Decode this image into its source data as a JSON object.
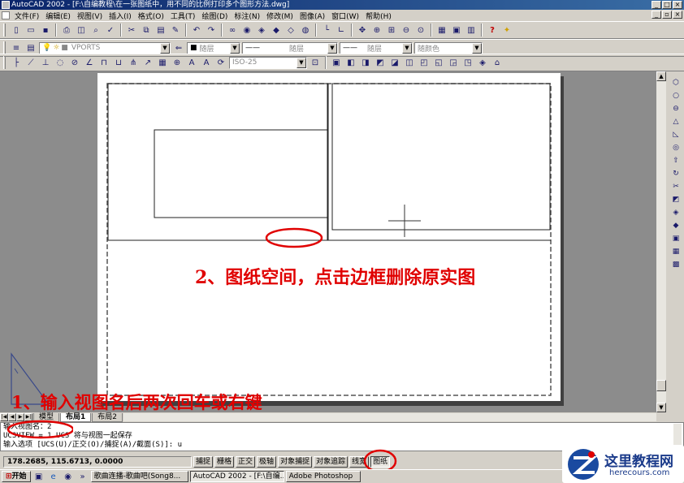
{
  "window": {
    "title": "AutoCAD 2002 - [F:\\自编教程\\在一张图纸中，用不同的比例打印多个图形方法.dwg]"
  },
  "menu": [
    "文件(F)",
    "编辑(E)",
    "视图(V)",
    "插入(I)",
    "格式(O)",
    "工具(T)",
    "绘图(D)",
    "标注(N)",
    "修改(M)",
    "图像(A)",
    "窗口(W)",
    "帮助(H)"
  ],
  "toolbar": {
    "layer_combo": "VPORTS",
    "color_combo": "随层",
    "linetype_combo": "随层",
    "lineweight_combo": "随层",
    "plotstyle_combo": "随颜色",
    "dimstyle_combo": "ISO-25"
  },
  "annotations": {
    "step2": "2、图纸空间，点击边框删除原实图",
    "step1": "1、输入视图名后两次回车或右键"
  },
  "tabs": [
    "模型",
    "布局1",
    "布局2"
  ],
  "active_tab": 1,
  "command_lines": [
    "输入视图名：2",
    "UCSVIEW = 1  UCS 将与视图一起保存",
    "输入选项 [UCS(U)/正交(O)/捕捉(A)/截面(S)]: u"
  ],
  "status": {
    "coords": "178.2685, 115.6713, 0.0000",
    "buttons": [
      "捕捉",
      "栅格",
      "正交",
      "极轴",
      "对象捕捉",
      "对象追踪",
      "线宽",
      "图纸"
    ],
    "on": [
      7
    ]
  },
  "taskbar": {
    "start": "开始",
    "items": [
      "歌曲连播-歌曲吧(Song8...",
      "AutoCAD 2002 - [F:\\自编...",
      "Adobe Photoshop"
    ],
    "active_index": 1
  },
  "watermark": {
    "title": "这里教程网",
    "url": "herecours.com"
  },
  "colors": {
    "annotation": "#e00000",
    "titlebar": "#0a246a",
    "paper": "#ffffff",
    "canvas": "#8c8c8c"
  }
}
